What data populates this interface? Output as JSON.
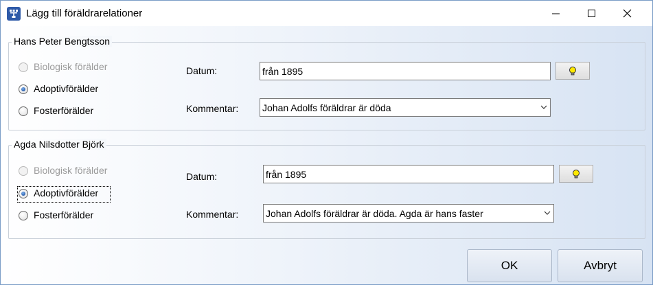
{
  "window": {
    "title": "Lägg till föräldrarelationer",
    "controls": [
      "minimize-icon",
      "maximize-icon",
      "close-icon"
    ]
  },
  "parent1": {
    "name": "Hans Peter Bengtsson",
    "options": {
      "biological": "Biologisk förälder",
      "adoptive": "Adoptivförälder",
      "foster": "Fosterförälder"
    },
    "selected": "adoptive",
    "date_label": "Datum:",
    "date_value": "från 1895",
    "comment_label": "Kommentar:",
    "comment_value": "Johan Adolfs föräldrar är döda"
  },
  "parent2": {
    "name": "Agda Nilsdotter Björk",
    "options": {
      "biological": "Biologisk förälder",
      "adoptive": "Adoptivförälder",
      "foster": "Fosterförälder"
    },
    "selected": "adoptive",
    "date_label": "Datum:",
    "date_value": "från 1895",
    "comment_label": "Kommentar:",
    "comment_value": "Johan Adolfs föräldrar är döda. Agda är hans faster"
  },
  "buttons": {
    "ok": "OK",
    "cancel": "Avbryt"
  },
  "icons": {
    "date_helper": "lightbulb-icon",
    "app": "family-tree-icon"
  },
  "colors": {
    "accent": "#1c4f9e",
    "bulb": "#ffe800"
  }
}
